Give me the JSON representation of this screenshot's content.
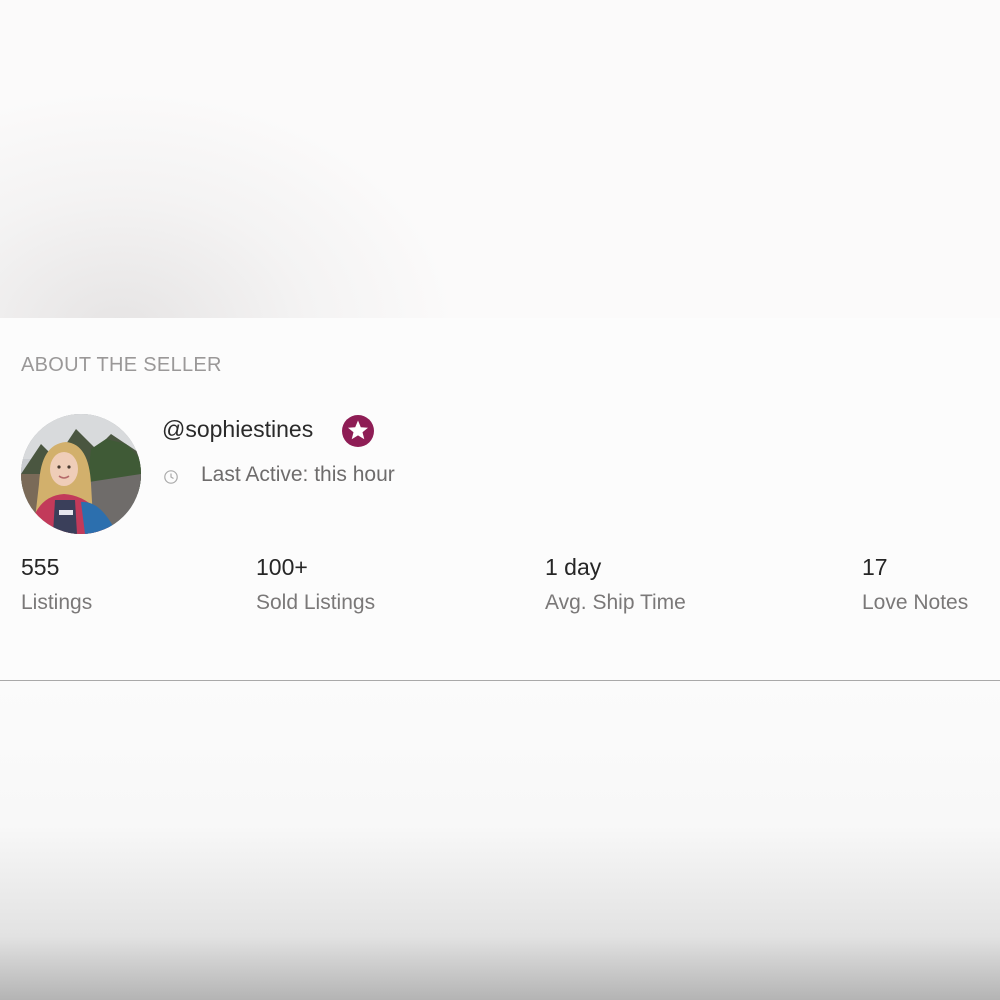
{
  "seller": {
    "section_title": "ABOUT THE SELLER",
    "username": "@sophiestines",
    "badge_icon": "star-badge-icon",
    "badge_color": "#8e1d55",
    "last_active": "Last Active: this hour"
  },
  "stats": [
    {
      "value": "555",
      "label": "Listings"
    },
    {
      "value": "100+",
      "label": "Sold Listings"
    },
    {
      "value": "1 day",
      "label": "Avg. Ship Time"
    },
    {
      "value": "17",
      "label": "Love Notes"
    }
  ]
}
